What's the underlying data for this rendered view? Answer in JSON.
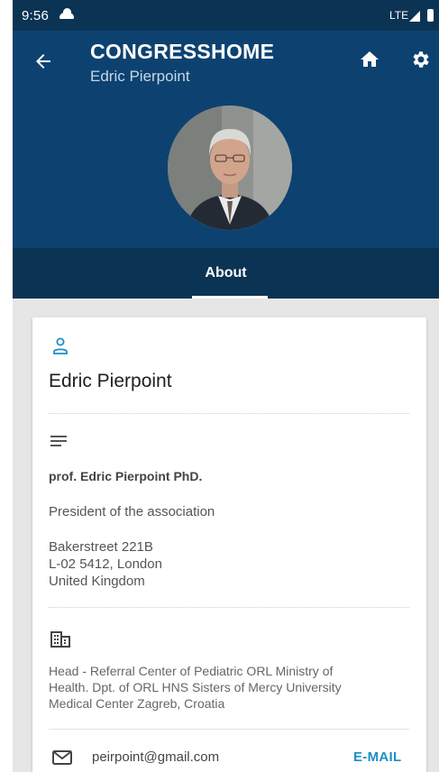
{
  "status_bar": {
    "time": "9:56",
    "network": "LTE"
  },
  "app_bar": {
    "title": "CONGRESSHOME",
    "subtitle": "Edric Pierpoint",
    "icons": [
      "back-arrow-icon",
      "home-icon",
      "gear-icon"
    ]
  },
  "tabs": [
    {
      "label": "About",
      "selected": true
    }
  ],
  "profile": {
    "name": "Edric Pierpoint",
    "full_title": "prof. Edric Pierpoint PhD.",
    "role": "President of the association",
    "address": [
      "Bakerstreet 221B",
      "L-02 5412, London",
      "United Kingdom"
    ],
    "organization": [
      "Head - Referral Center of Pediatric ORL Ministry of",
      "Health. Dpt. of ORL HNS Sisters of Mercy University",
      "Medical Center Zagreb, Croatia"
    ],
    "email": "peirpoint@gmail.com",
    "email_action": "E-MAIL"
  },
  "colors": {
    "status_bar": "#0b3354",
    "app_bar": "#0d4270",
    "accent": "#1c8fc6",
    "background": "#e6e6e6"
  }
}
